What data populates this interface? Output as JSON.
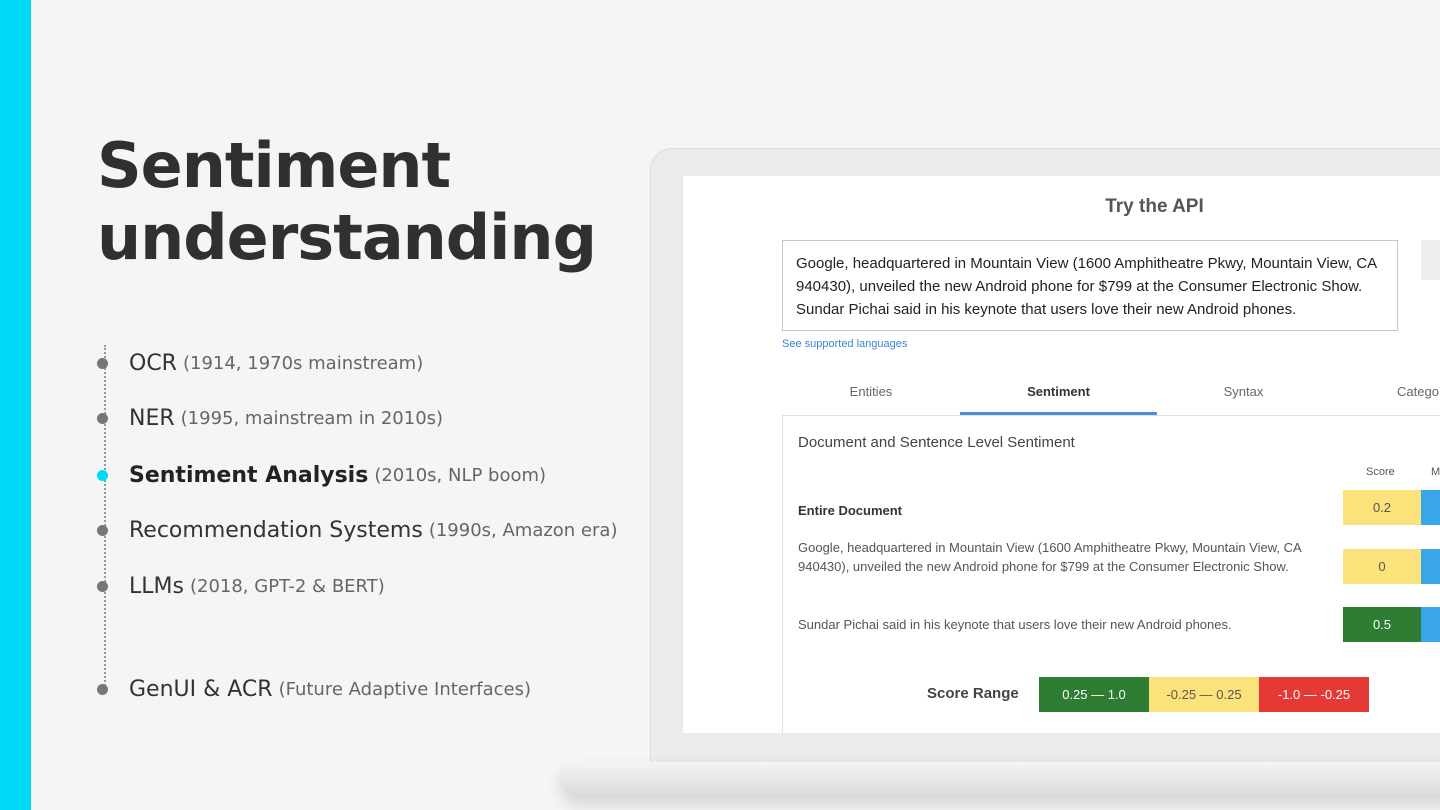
{
  "slide": {
    "title_line1": "Sentiment",
    "title_line2": "understanding",
    "accent_color": "#00d9f5"
  },
  "timeline": [
    {
      "name": "OCR",
      "note": "(1914, 1970s mainstream)",
      "active": false
    },
    {
      "name": "NER",
      "note": "(1995, mainstream in 2010s)",
      "active": false
    },
    {
      "name": "Sentiment Analysis",
      "note": "(2010s, NLP boom)",
      "active": true
    },
    {
      "name": "Recommendation Systems",
      "note": "(1990s, Amazon era)",
      "active": false
    },
    {
      "name": "LLMs",
      "note": "(2018, GPT-2 & BERT)",
      "active": false
    },
    {
      "name": "GenUI & ACR",
      "note": "(Future Adaptive Interfaces)",
      "active": false
    }
  ],
  "api": {
    "title": "Try the API",
    "input_text": "Google, headquartered in Mountain View (1600 Amphitheatre Pkwy, Mountain View, CA 940430), unveiled the new Android phone for $799 at the Consumer Electronic Show. Sundar Pichai said in his keynote that users love their new Android phones.",
    "languages_link": "See supported languages",
    "tabs": [
      "Entities",
      "Sentiment",
      "Syntax",
      "Catego"
    ],
    "active_tab": "Sentiment",
    "panel_title": "Document and Sentence Level Sentiment",
    "col_score": "Score",
    "col_magnitude": "M",
    "rows": [
      {
        "label": "Entire Document",
        "score": "0.2",
        "color": "#fce27a"
      },
      {
        "label": "Google, headquartered in Mountain View (1600 Amphitheatre Pkwy, Mountain View, CA 940430), unveiled the new Android phone for $799 at the Consumer Electronic Show.",
        "score": "0",
        "color": "#fce27a"
      },
      {
        "label": "Sundar Pichai said in his keynote that users love their new Android phones.",
        "score": "0.5",
        "color": "#2e7d32"
      }
    ],
    "score_range_label": "Score Range",
    "ranges": [
      "0.25 — 1.0",
      "-0.25 — 0.25",
      "-1.0 — -0.25"
    ]
  }
}
